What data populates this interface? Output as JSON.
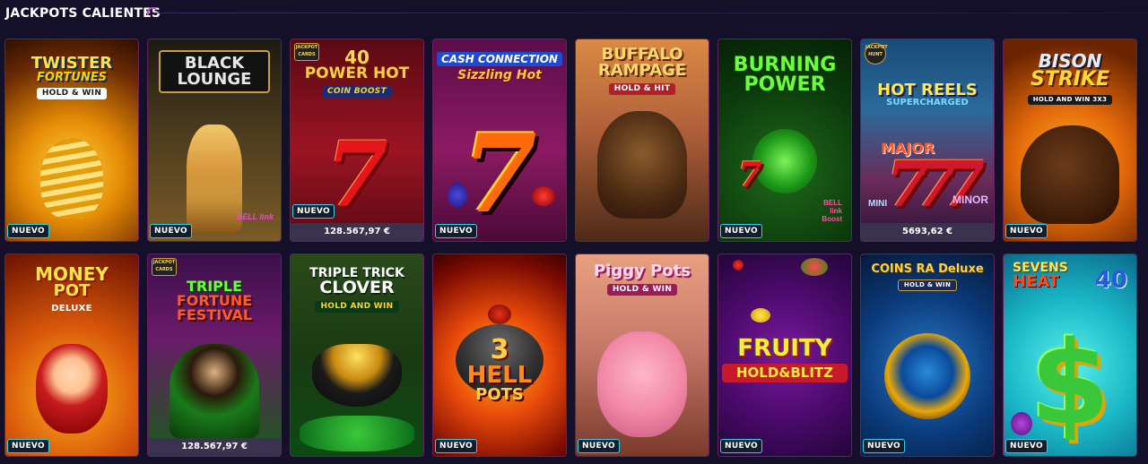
{
  "section": {
    "title": "JACKPOTS CALIENTES",
    "accent": "#c04bd6"
  },
  "badge_color": "#2fd0f0",
  "cards": [
    {
      "id": "twister-fortunes",
      "title_lines": [
        "TWISTER",
        "FORTUNES"
      ],
      "subtitle": "HOLD & WIN",
      "badge": "NUEVO",
      "jackpot": null
    },
    {
      "id": "black-lounge",
      "title_lines": [
        "BLACK",
        "LOUNGE"
      ],
      "subtitle": "",
      "badge": "NUEVO",
      "jackpot": null
    },
    {
      "id": "power-hot",
      "title_lines": [
        "40",
        "POWER HOT"
      ],
      "subtitle": "COIN BOOST",
      "badge": "NUEVO",
      "jackpot": "128.567,97 €"
    },
    {
      "id": "cash-connection",
      "title_lines": [
        "CASH CONNECTION",
        "Sizzling Hot"
      ],
      "subtitle": "",
      "badge": "NUEVO",
      "jackpot": null
    },
    {
      "id": "buffalo-rampage",
      "title_lines": [
        "BUFFALO",
        "RAMPAGE"
      ],
      "subtitle": "HOLD & HIT",
      "badge": null,
      "jackpot": null
    },
    {
      "id": "burning-power",
      "title_lines": [
        "BURNING",
        "POWER"
      ],
      "subtitle": "",
      "badge": "NUEVO",
      "jackpot": null
    },
    {
      "id": "hot-reels",
      "title_lines": [
        "HOT REELS",
        "SUPERCHARGED"
      ],
      "subtitle": "",
      "badge": null,
      "jackpot": "5693,62 €"
    },
    {
      "id": "bison-strike",
      "title_lines": [
        "BISON",
        "STRIKE"
      ],
      "subtitle": "HOLD AND WIN 3x3",
      "badge": "NUEVO",
      "jackpot": null
    },
    {
      "id": "money-pot",
      "title_lines": [
        "MONEY",
        "POT"
      ],
      "subtitle": "DELUXE",
      "badge": "NUEVO",
      "jackpot": null
    },
    {
      "id": "triple-fortune-festival",
      "title_lines": [
        "TRIPLE",
        "FORTUNE",
        "FESTIVAL"
      ],
      "subtitle": "",
      "badge": null,
      "jackpot": "128.567,97 €"
    },
    {
      "id": "triple-trick-clover",
      "title_lines": [
        "TRIPLE TRICK",
        "CLOVER"
      ],
      "subtitle": "HOLD AND WIN",
      "badge": null,
      "jackpot": null
    },
    {
      "id": "hell-pots",
      "title_lines": [
        "3",
        "HELL",
        "POTS"
      ],
      "subtitle": "",
      "badge": "NUEVO",
      "jackpot": null
    },
    {
      "id": "piggy-pots",
      "title_lines": [
        "Piggy Pots"
      ],
      "subtitle": "HOLD & WIN",
      "badge": "NUEVO",
      "jackpot": null
    },
    {
      "id": "fruity-hold-blitz",
      "title_lines": [
        "FRUITY",
        "HOLD&BLITZ"
      ],
      "subtitle": "",
      "badge": "NUEVO",
      "jackpot": null
    },
    {
      "id": "coins-of-ra",
      "title_lines": [
        "COINS RA Deluxe"
      ],
      "subtitle": "HOLD & WIN",
      "badge": "NUEVO",
      "jackpot": null
    },
    {
      "id": "sevens-heat",
      "title_lines": [
        "SEVENS",
        "HEAT",
        "40"
      ],
      "subtitle": "",
      "badge": "NUEVO",
      "jackpot": null
    }
  ],
  "mini_tags": {
    "jackpot_cards": "JACKPOT CARDS",
    "jackpot_hunt": "JACKPOT HUNT",
    "bell_link": "BELL link",
    "bell_link_boost": "BELL link Boost",
    "major": "MAJOR",
    "mini": "MINI",
    "minor": "MINOR"
  }
}
